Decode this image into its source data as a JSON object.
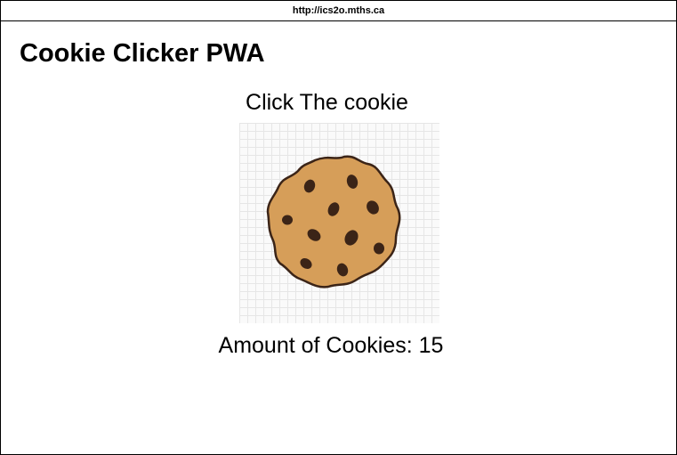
{
  "browser": {
    "url": "http://ics2o.mths.ca"
  },
  "page": {
    "title": "Cookie Clicker PWA",
    "instruction": "Click The cookie"
  },
  "cookie": {
    "icon": "cookie-icon",
    "dough_color": "#d69e59",
    "outline_color": "#3b2417",
    "chip_color": "#3b2417"
  },
  "counter": {
    "label": "Amount of Cookies: ",
    "value": 15
  }
}
